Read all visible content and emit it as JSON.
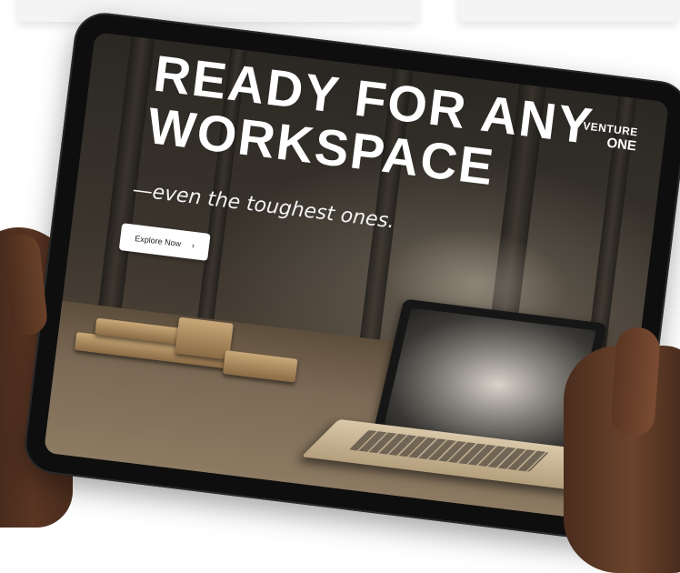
{
  "hero": {
    "headline_line1": "READY FOR ANY",
    "headline_line2": "WORKSPACE",
    "subline": "—even the toughest ones.",
    "cta_label": "Explore Now",
    "cta_arrow": "›"
  },
  "brand": {
    "line1": "VENTURE",
    "line2": "ONE"
  }
}
